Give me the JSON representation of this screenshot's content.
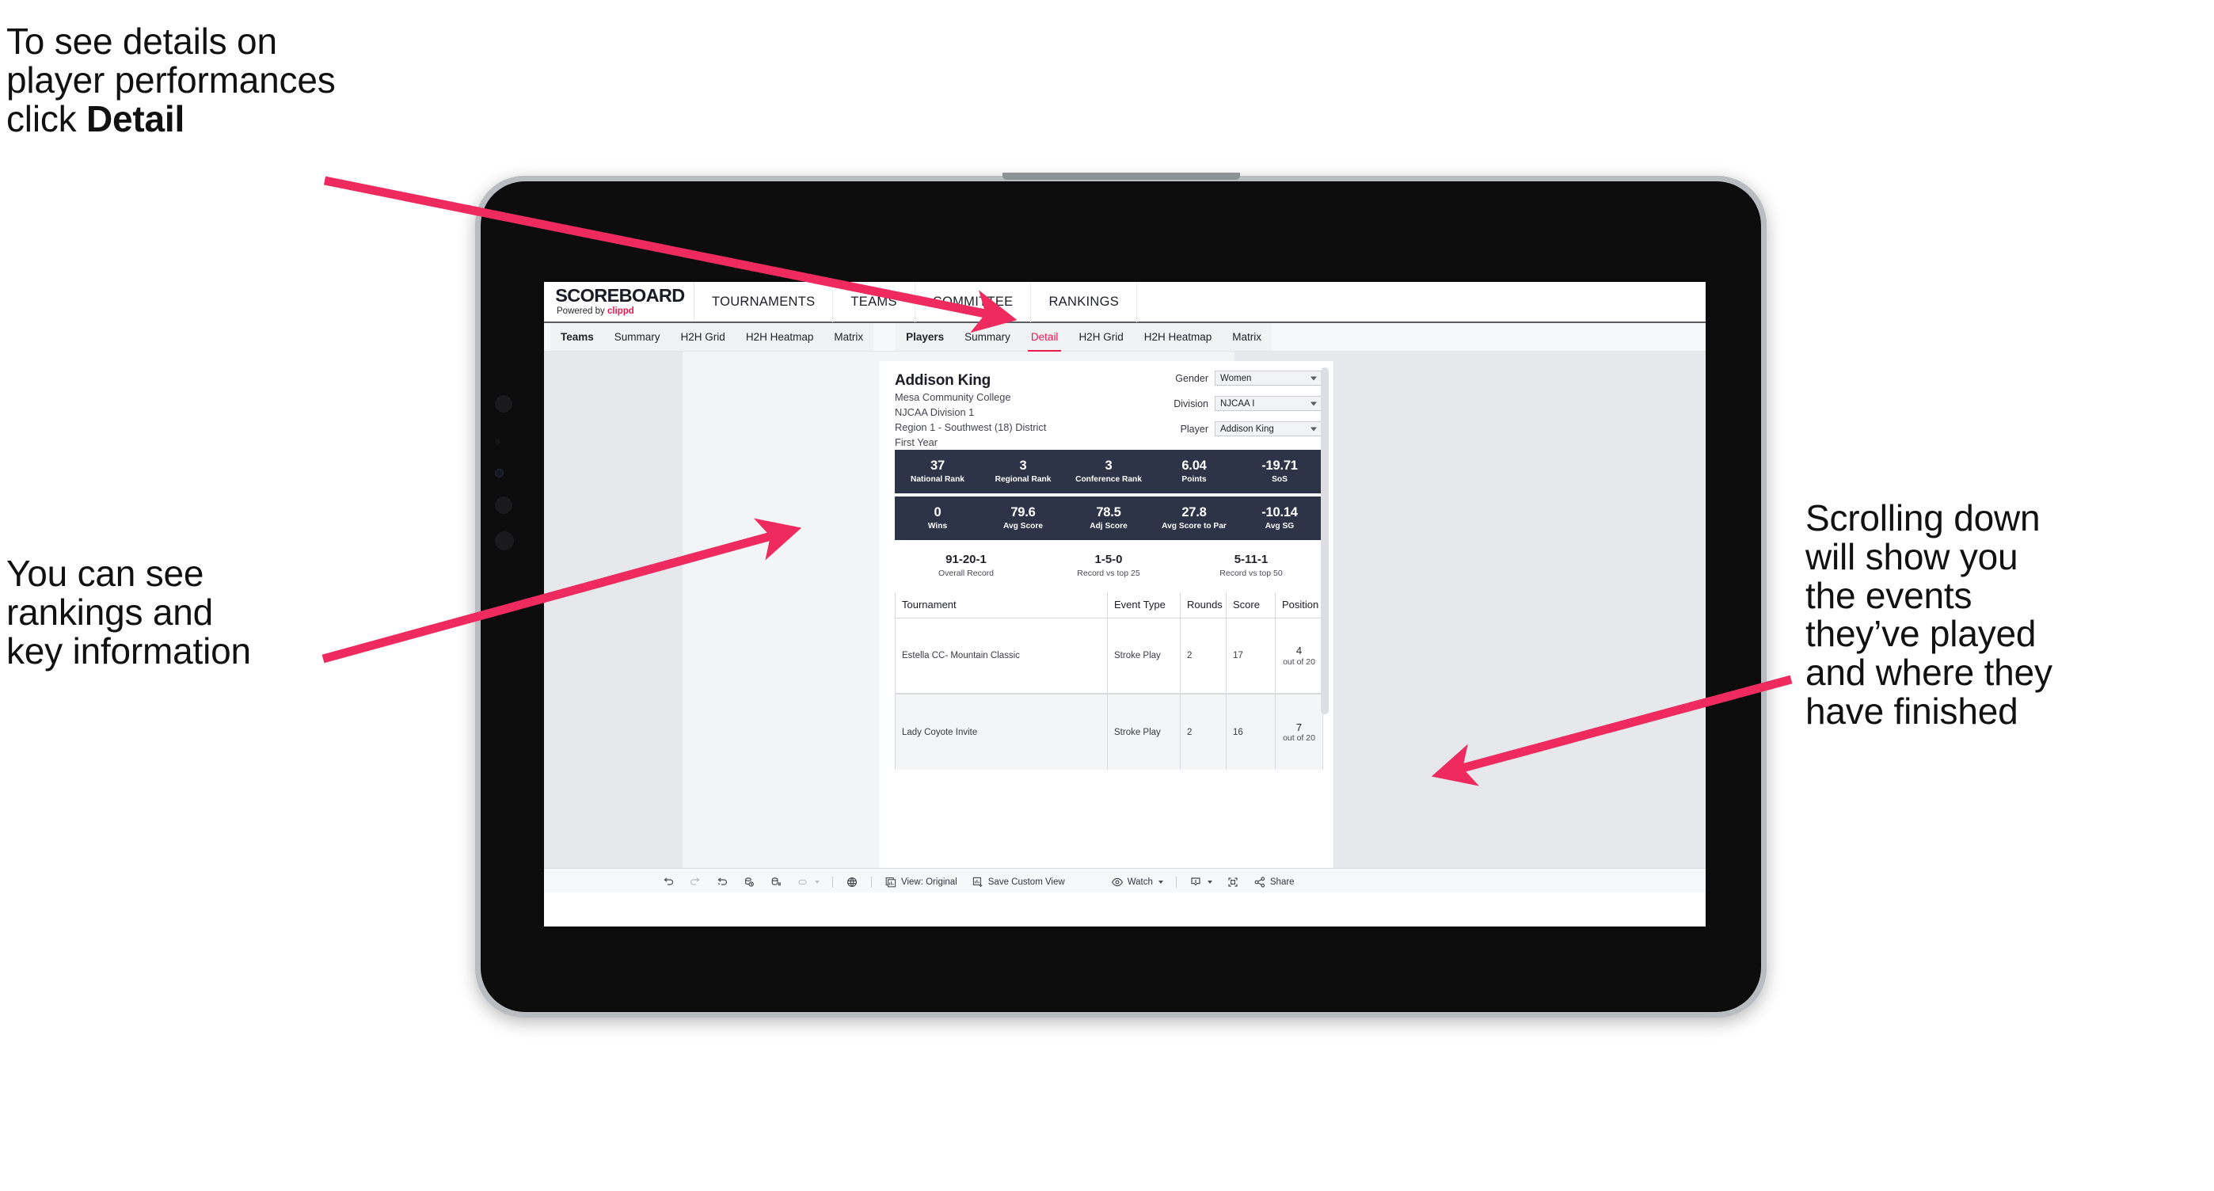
{
  "annotations": {
    "top_left": "To see details on\nplayer performances\nclick ",
    "top_left_bold": "Detail",
    "mid_left": "You can see\nrankings and\nkey information",
    "right": "Scrolling down\nwill show you\nthe events\nthey’ve played\nand where they\nhave finished",
    "arrow_color": "#ee2a5e"
  },
  "app": {
    "brand_title": "SCOREBOARD",
    "brand_powered_prefix": "Powered by ",
    "brand_powered_name": "clippd",
    "accent_color": "#e8194f",
    "top_nav": [
      {
        "label": "TOURNAMENTS"
      },
      {
        "label": "TEAMS"
      },
      {
        "label": "COMMITTEE"
      },
      {
        "label": "RANKINGS"
      }
    ],
    "sub_nav_group_teams": [
      {
        "label": "Teams",
        "head": true,
        "active": false
      },
      {
        "label": "Summary",
        "head": false,
        "active": false
      },
      {
        "label": "H2H Grid",
        "head": false,
        "active": false
      },
      {
        "label": "H2H Heatmap",
        "head": false,
        "active": false
      },
      {
        "label": "Matrix",
        "head": false,
        "active": false
      }
    ],
    "sub_nav_group_players": [
      {
        "label": "Players",
        "head": true,
        "active": false
      },
      {
        "label": "Summary",
        "head": false,
        "active": false
      },
      {
        "label": "Detail",
        "head": false,
        "active": true
      },
      {
        "label": "H2H Grid",
        "head": false,
        "active": false
      },
      {
        "label": "H2H Heatmap",
        "head": false,
        "active": false
      },
      {
        "label": "Matrix",
        "head": false,
        "active": false
      }
    ]
  },
  "player": {
    "name": "Addison King",
    "school": "Mesa Community College",
    "division": "NJCAA Division 1",
    "region": "Region 1 - Southwest (18) District",
    "class_year": "First Year"
  },
  "filters": [
    {
      "label": "Gender",
      "value": "Women"
    },
    {
      "label": "Division",
      "value": "NJCAA I"
    },
    {
      "label": "Player",
      "value": "Addison King"
    }
  ],
  "stats_row_1": [
    {
      "value": "37",
      "label": "National Rank"
    },
    {
      "value": "3",
      "label": "Regional Rank"
    },
    {
      "value": "3",
      "label": "Conference Rank"
    },
    {
      "value": "6.04",
      "label": "Points"
    },
    {
      "value": "-19.71",
      "label": "SoS"
    }
  ],
  "stats_row_2": [
    {
      "value": "0",
      "label": "Wins"
    },
    {
      "value": "79.6",
      "label": "Avg Score"
    },
    {
      "value": "78.5",
      "label": "Adj Score"
    },
    {
      "value": "27.8",
      "label": "Avg Score to Par"
    },
    {
      "value": "-10.14",
      "label": "Avg SG"
    }
  ],
  "records": [
    {
      "value": "91-20-1",
      "label": "Overall Record"
    },
    {
      "value": "1-5-0",
      "label": "Record vs top 25"
    },
    {
      "value": "5-11-1",
      "label": "Record vs top 50"
    }
  ],
  "tournaments_table": {
    "columns": [
      "Tournament",
      "Event Type",
      "Rounds",
      "Score",
      "Position"
    ],
    "rows": [
      {
        "tournament": "Estella CC- Mountain Classic",
        "event_type": "Stroke Play",
        "rounds": "2",
        "score": "17",
        "position_num": "4",
        "position_of": "out of 20"
      },
      {
        "tournament": "Lady Coyote Invite",
        "event_type": "Stroke Play",
        "rounds": "2",
        "score": "16",
        "position_num": "7",
        "position_of": "out of 20"
      }
    ]
  },
  "toolbar": {
    "view_label": "View: Original",
    "save_label": "Save Custom View",
    "watch_label": "Watch",
    "share_label": "Share",
    "icons": [
      "undo-icon",
      "redo-icon",
      "revert-icon",
      "refresh-icon",
      "pause-icon",
      "highlight-icon",
      "dashboard-icon"
    ]
  }
}
